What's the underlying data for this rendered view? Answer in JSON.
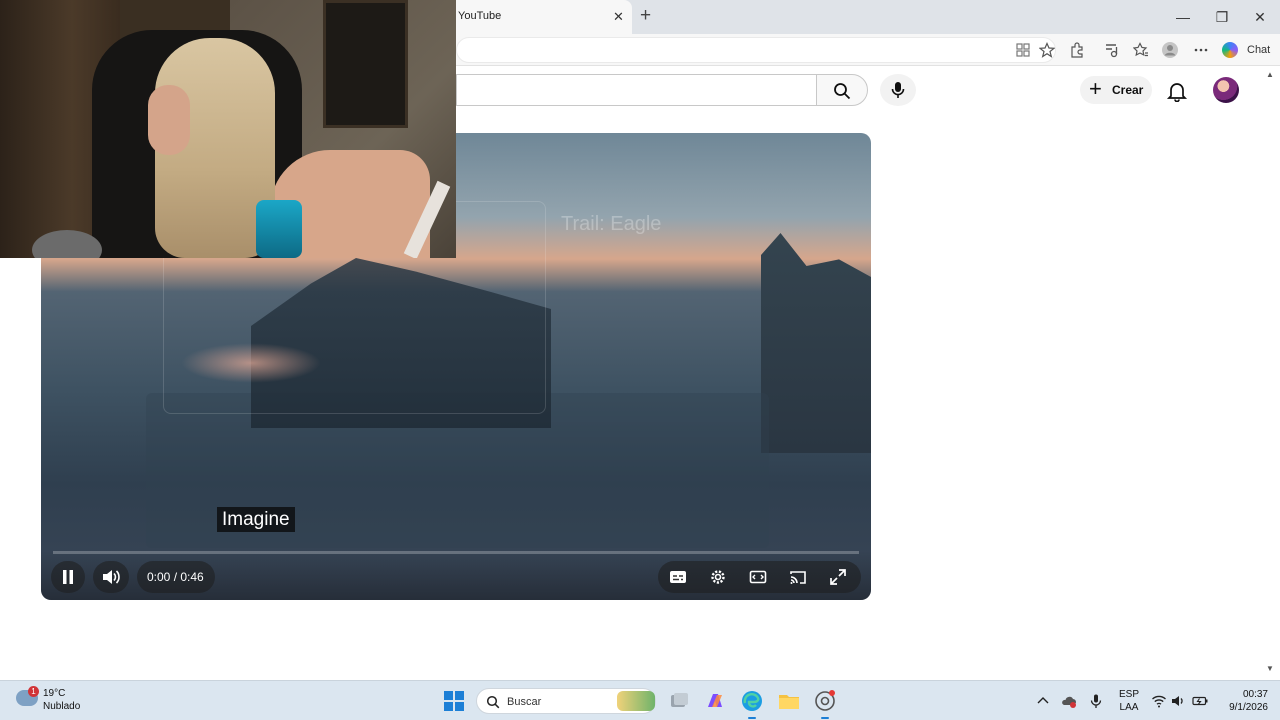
{
  "browser": {
    "tab_title": "YouTube",
    "tab_close": "✕",
    "new_tab": "+",
    "chat_label": "Chat",
    "window_controls": {
      "minimize": "—",
      "restore": "❐",
      "close": "✕"
    }
  },
  "youtube": {
    "create_label": "Crear",
    "create_plus": "+"
  },
  "player": {
    "overlay_title": "Trail: Eagle",
    "caption": "Imagine",
    "time": "0:00 / 0:46",
    "progress_fraction": 0.0,
    "state": "playing"
  },
  "taskbar": {
    "weather_badge": "1",
    "weather_temp": "19°C",
    "weather_desc": "Nublado",
    "search_placeholder": "Buscar",
    "lang_line1": "ESP",
    "lang_line2": "LAA",
    "time": "00:37",
    "date": "9/1/2026"
  },
  "colors": {
    "progress": "#ff0033",
    "start_accent": "#1c7fd6",
    "badge": "#d13438"
  },
  "icons": [
    "search-icon",
    "mic-icon",
    "bell-icon",
    "pause-icon",
    "volume-icon",
    "subtitles-icon",
    "settings-icon",
    "theater-icon",
    "cast-icon",
    "fullscreen-icon",
    "windows-start-icon",
    "edge-icon",
    "file-explorer-icon",
    "copilot-icon",
    "chrome-icon",
    "wifi-icon",
    "speaker-icon",
    "battery-icon"
  ]
}
